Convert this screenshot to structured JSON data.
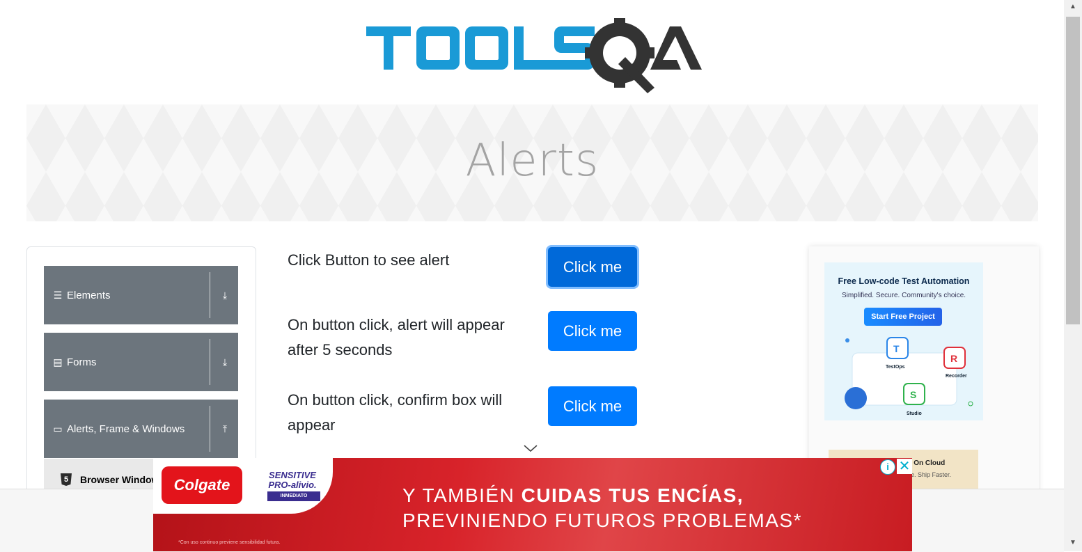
{
  "header": {
    "logo_text": "TOOLSQA"
  },
  "banner": {
    "title": "Alerts"
  },
  "sidebar": {
    "groups": [
      {
        "label": "Elements",
        "icon": "hamburger-icon",
        "arrow": "download-icon"
      },
      {
        "label": "Forms",
        "icon": "document-icon",
        "arrow": "download-icon"
      },
      {
        "label": "Alerts, Frame & Windows",
        "icon": "window-icon",
        "arrow": "upload-icon"
      }
    ],
    "sub_items": [
      {
        "label": "Browser Windows",
        "icon": "html5-icon"
      }
    ]
  },
  "main": {
    "rows": [
      {
        "text": "Click Button to see alert",
        "button": "Click me",
        "focused": true
      },
      {
        "text": "On button click, alert will appear after 5 seconds",
        "button": "Click me",
        "focused": false
      },
      {
        "text": "On button click, confirm box will appear",
        "button": "Click me",
        "focused": false
      }
    ]
  },
  "side_ad": {
    "title": "Free Low-code Test Automation",
    "subtitle": "Simplified. Secure. Community's choice.",
    "cta": "Start Free Project",
    "labels": [
      "TestOps",
      "Recorder",
      "Studio"
    ],
    "card2_text": "esting On Cloud",
    "card2_sub": "e. Ship Faster."
  },
  "bottom_ad": {
    "brand": "Colgate",
    "product_line1": "SENSITIVE",
    "product_line2": "PRO-alivio.",
    "product_tag": "INMEDIATO",
    "line1_normal": "Y TAMBIÉN ",
    "line1_bold": "CUIDAS TUS ENCÍAS,",
    "line2": "PREVINIENDO FUTUROS PROBLEMAS*",
    "fineprint": "*Con uso continuo previene sensibilidad futura.",
    "info_icon": "i",
    "close_icon": "✕"
  },
  "colors": {
    "primary": "#007bff",
    "sidebar_group": "#6c757d",
    "toolsqa_blue": "#1a9ad6",
    "toolsqa_dark": "#333333"
  }
}
